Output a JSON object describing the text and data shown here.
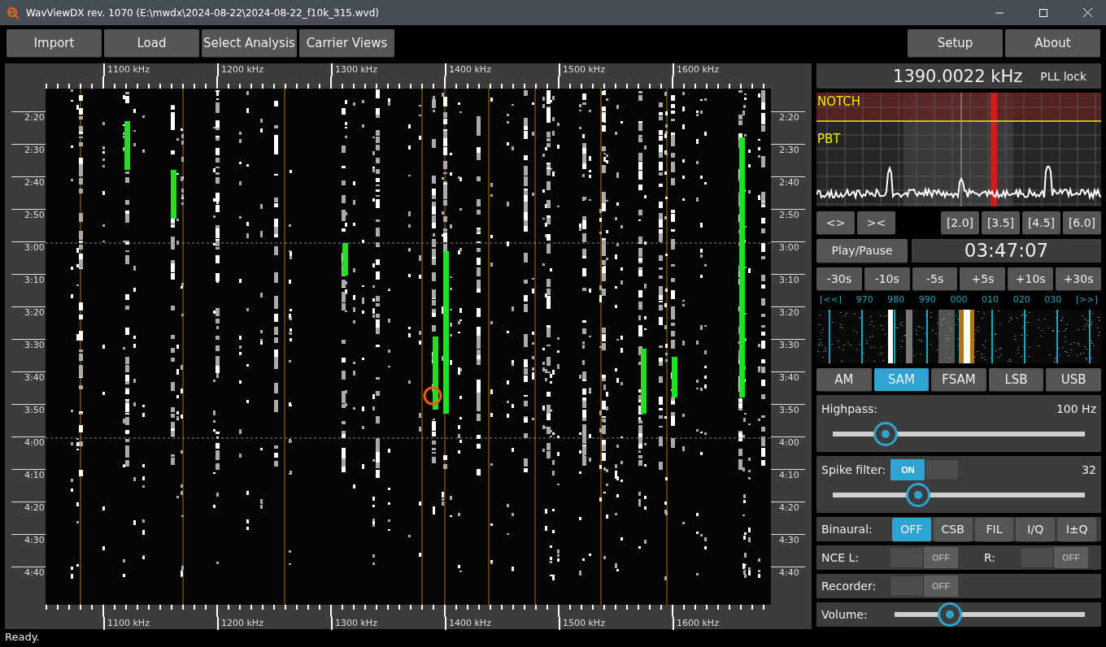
{
  "window": {
    "title": "WavViewDX rev. 1070 (E:\\mwdx\\2024-08-22\\2024-08-22_f10k_315.wvd)"
  },
  "toolbar": {
    "left": [
      "Import",
      "Load",
      "Select Analysis",
      "Carrier Views"
    ],
    "right": [
      "Setup",
      "About"
    ]
  },
  "waterfall": {
    "freq_labels_top": [
      "1100 kHz",
      "1200 kHz",
      "1300 kHz",
      "1400 kHz",
      "1500 kHz",
      "1600 kHz"
    ],
    "time_labels_left": [
      "2:20",
      "2:30",
      "2:40",
      "2:50",
      "3:00",
      "3:10",
      "3:20",
      "3:30",
      "3:40",
      "3:50",
      "4:00",
      "4:10",
      "4:20",
      "4:30",
      "4:40"
    ],
    "time_labels_right": [
      "2:20",
      "2:30",
      "2:40",
      "2:50",
      "3:00",
      "3:10",
      "3:20",
      "3:30",
      "3:40",
      "3:50",
      "4:00",
      "4:10",
      "4:20",
      "4:30",
      "4:40"
    ],
    "freq_labels_bottom": [
      "1100 kHz",
      "1200 kHz",
      "1300 kHz",
      "1400 kHz",
      "1500 kHz",
      "1600 kHz"
    ]
  },
  "tuning": {
    "frequency": "1390.0022 kHz",
    "lock": "PLL lock"
  },
  "spectrum": {
    "notch_label": "NOTCH",
    "pbt_label": "PBT"
  },
  "bandwidth": {
    "shift": [
      "<>",
      "><"
    ],
    "presets": [
      "[2.0]",
      "[3.5]",
      "[4.5]",
      "[6.0]"
    ]
  },
  "playback": {
    "play": "Play/Pause",
    "time": "03:47:07",
    "skips": [
      "-30s",
      "-10s",
      "-5s",
      "+5s",
      "+10s",
      "+30s"
    ]
  },
  "channel_scale": [
    "[<<]",
    "970",
    "980",
    "990",
    "000",
    "010",
    "020",
    "030",
    "[>>]"
  ],
  "modes": [
    {
      "label": "AM",
      "selected": false
    },
    {
      "label": "SAM",
      "selected": true
    },
    {
      "label": "FSAM",
      "selected": false
    },
    {
      "label": "LSB",
      "selected": false
    },
    {
      "label": "USB",
      "selected": false
    }
  ],
  "highpass": {
    "label": "Highpass:",
    "reading": "100 Hz",
    "level": 0.21
  },
  "spike_filter": {
    "label": "Spike filter:",
    "toggle": {
      "label": "ON",
      "on": true
    },
    "reading": "32",
    "level": 0.34
  },
  "binaural": {
    "label": "Binaural:",
    "options": [
      {
        "label": "OFF",
        "selected": true
      },
      {
        "label": "CSB",
        "selected": false
      },
      {
        "label": "FIL",
        "selected": false
      },
      {
        "label": "I/Q",
        "selected": false
      },
      {
        "label": "I±Q",
        "selected": false
      }
    ]
  },
  "nce": {
    "label": "NCE L:",
    "left": {
      "label": "OFF",
      "on": false
    },
    "right_label": "R:",
    "right": {
      "label": "OFF",
      "on": false
    }
  },
  "recorder": {
    "label": "Recorder:",
    "toggle": {
      "label": "OFF",
      "on": false
    }
  },
  "volume": {
    "label": "Volume:",
    "level": 0.29
  },
  "status_bar": "Ready."
}
